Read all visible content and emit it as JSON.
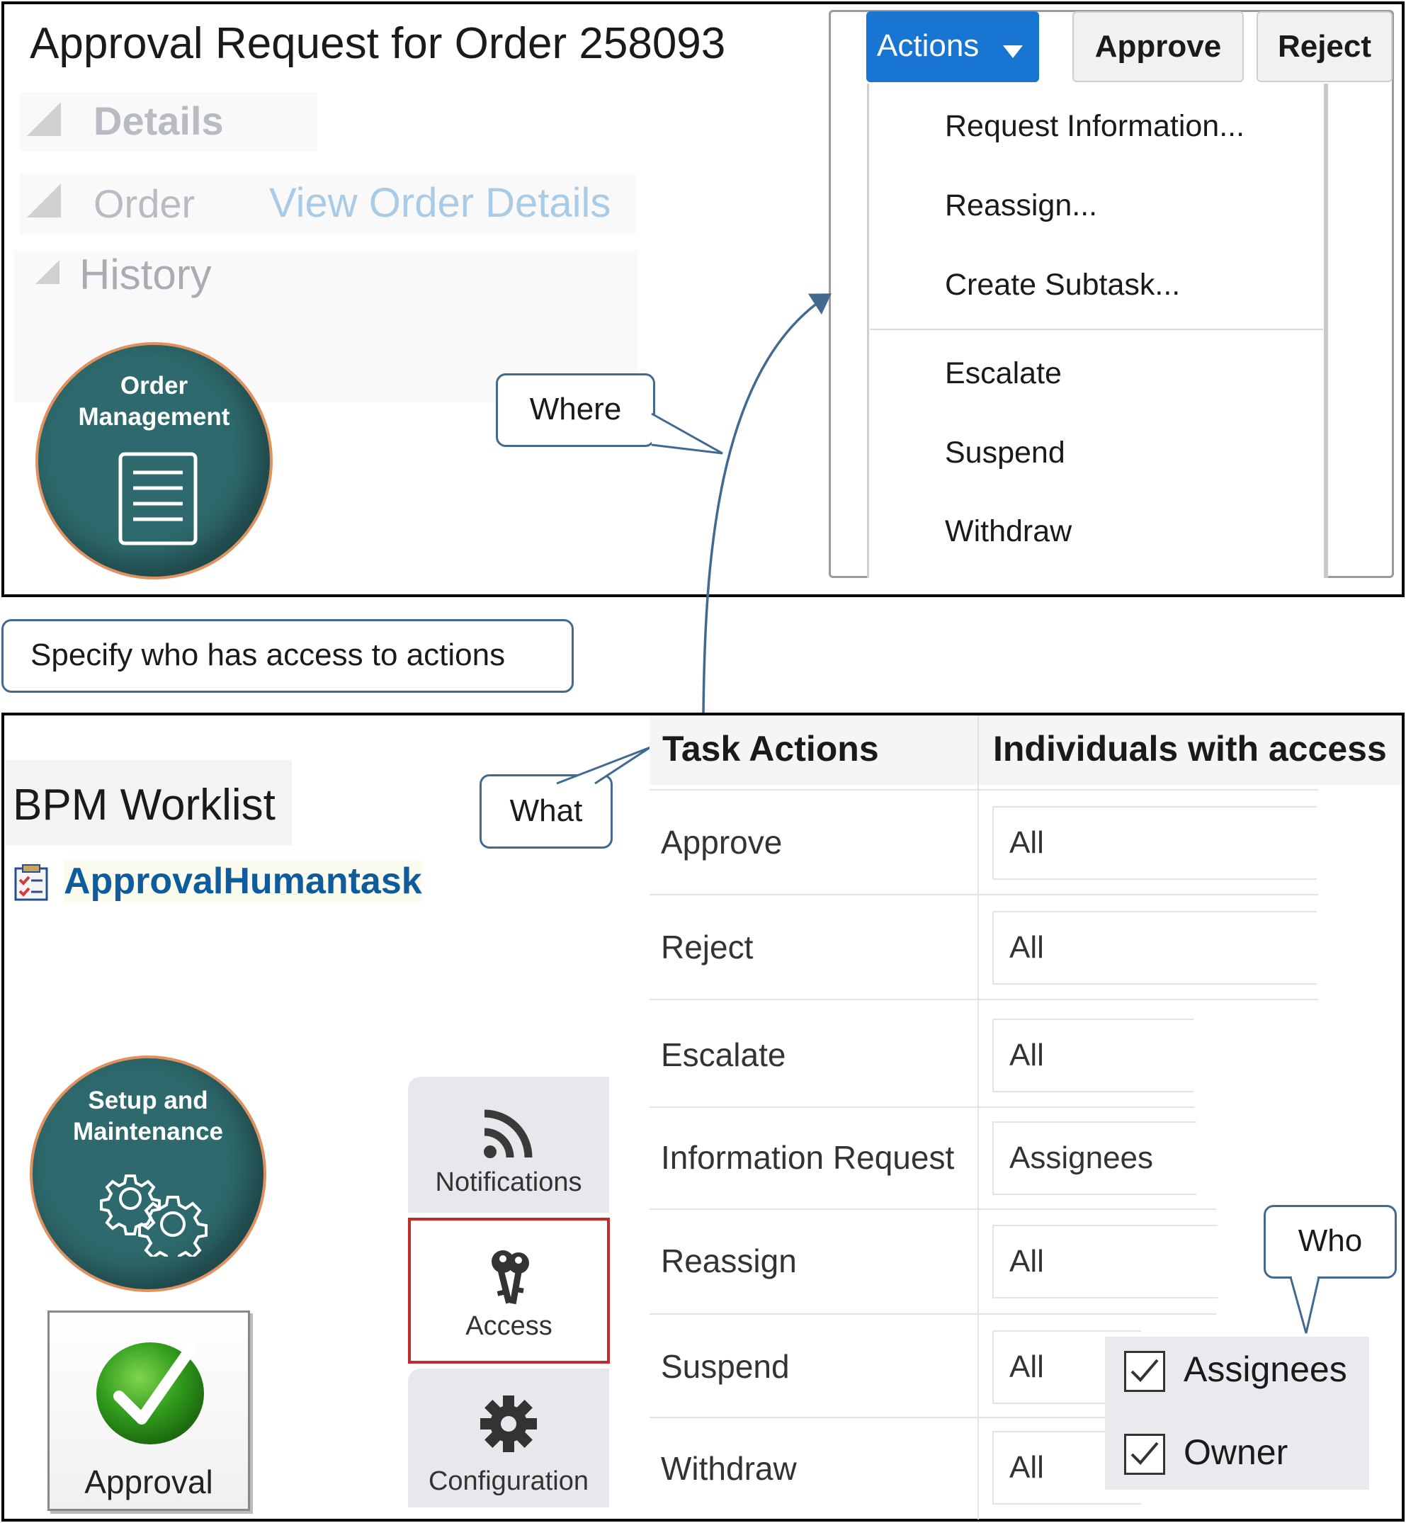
{
  "top": {
    "title_text": "Approval Request for Order",
    "order_number": "258093",
    "sections": {
      "details": "Details",
      "order": "Order",
      "view_order_details": "View Order Details",
      "history": "History"
    },
    "order_management_badge": "Order\nManagement",
    "toolbar": {
      "actions_label": "Actions",
      "approve_label": "Approve",
      "reject_label": "Reject"
    },
    "actions_menu": {
      "group1": [
        "Request Information...",
        "Reassign...",
        "Create Subtask..."
      ],
      "group2": [
        "Escalate",
        "Suspend",
        "Withdraw"
      ]
    }
  },
  "callouts": {
    "where": "Where",
    "specify": "Specify who has access to actions",
    "what": "What",
    "who": "Who"
  },
  "bottom": {
    "bpm_title": "BPM Worklist",
    "human_task_link": "ApprovalHumantask",
    "setup_badge": "Setup and\nMaintenance",
    "approval_tile": "Approval",
    "tabs": {
      "notifications": "Notifications",
      "access": "Access",
      "configuration": "Configuration"
    },
    "table": {
      "headers": [
        "Task Actions",
        "Individuals with access"
      ],
      "rows": [
        {
          "action": "Approve",
          "access": "All"
        },
        {
          "action": "Reject",
          "access": "All"
        },
        {
          "action": "Escalate",
          "access": "All"
        },
        {
          "action": "Information Request",
          "access": "Assignees"
        },
        {
          "action": "Reassign",
          "access": "All"
        },
        {
          "action": "Suspend",
          "access": "All"
        },
        {
          "action": "Withdraw",
          "access": "All"
        }
      ]
    },
    "who_options": [
      {
        "label": "Assignees",
        "checked": true
      },
      {
        "label": "Owner",
        "checked": true
      }
    ]
  },
  "colors": {
    "actions_button": "#1875d1",
    "badge_fill": "#2e6a6d",
    "badge_ring": "#e1915e",
    "callout_border": "#42698f",
    "access_highlight": "#c32a2a",
    "link": "#0f5c9c"
  }
}
